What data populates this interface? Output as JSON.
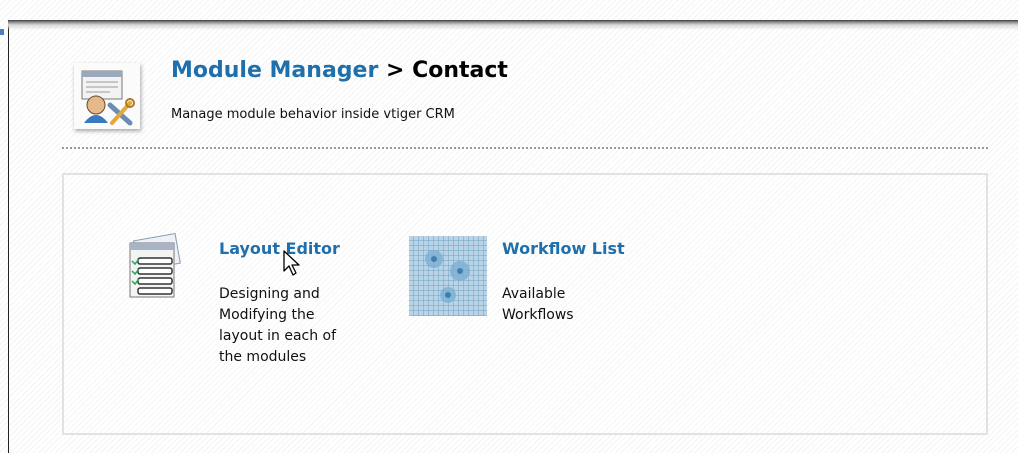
{
  "header": {
    "breadcrumb_link": "Module Manager",
    "separator": " > ",
    "module_name": "Contact",
    "subtitle": "Manage module behavior inside vtiger CRM"
  },
  "tools": [
    {
      "icon": "layout-editor-icon",
      "label": "Layout Editor",
      "description_lines": [
        "Designing and",
        "Modifying the",
        "layout in each of",
        "the modules"
      ]
    },
    {
      "icon": "workflow-list-icon",
      "label": "Workflow List",
      "description_lines": [
        "Available",
        "Workflows"
      ]
    }
  ],
  "colors": {
    "link": "#1e6fab",
    "text": "#111111",
    "panel_border": "#e2e2e2"
  }
}
